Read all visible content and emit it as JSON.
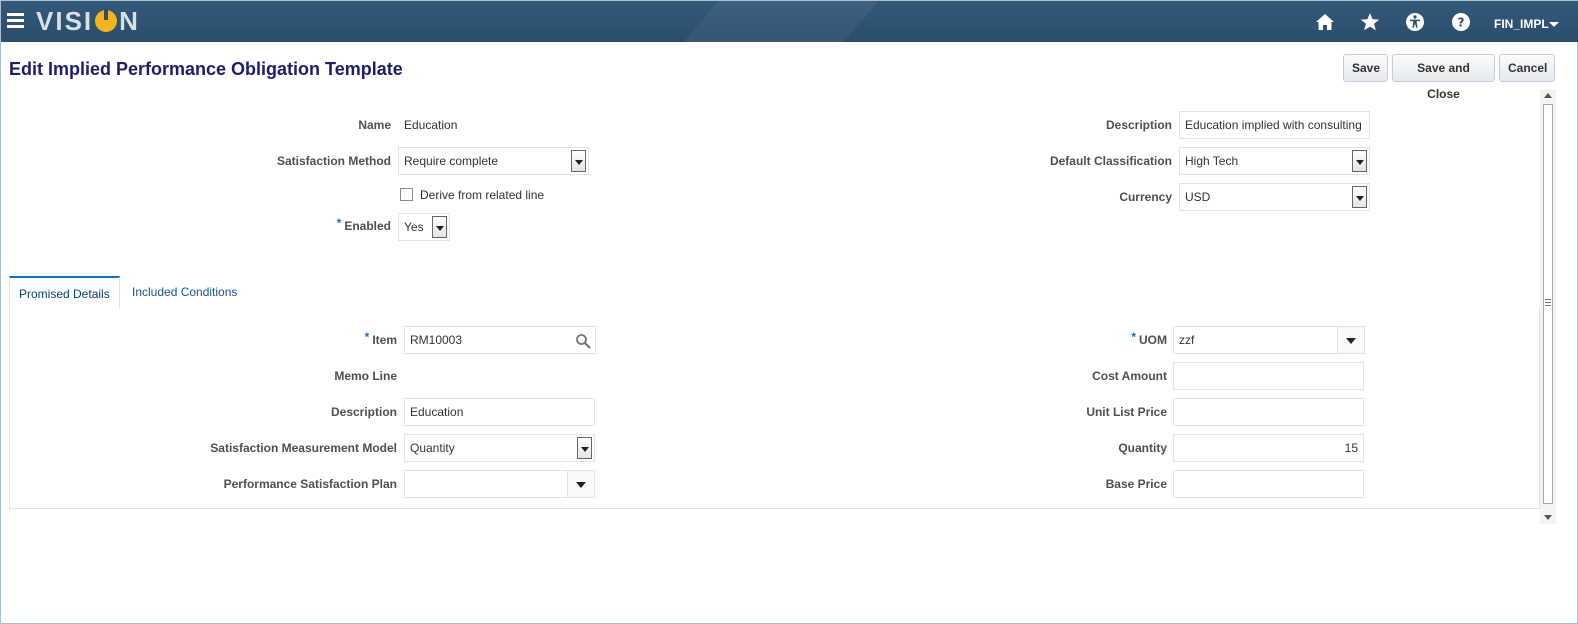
{
  "header": {
    "logo_text_left": "VISI",
    "logo_text_right": "N",
    "user": "FIN_IMPL",
    "icons": [
      "home-icon",
      "favorites-star-icon",
      "accessibility-icon",
      "help-icon"
    ]
  },
  "page": {
    "title": "Edit Implied Performance Obligation Template",
    "buttons": {
      "save": "Save",
      "save_and_close": "Save and Close",
      "cancel": "Cancel"
    }
  },
  "form": {
    "name_label": "Name",
    "name_value": "Education",
    "satisfaction_method_label": "Satisfaction Method",
    "satisfaction_method_value": "Require complete",
    "derive_label": "Derive from related line",
    "derive_checked": false,
    "enabled_label": "Enabled",
    "enabled_value": "Yes",
    "description_label": "Description",
    "description_value": "Education implied with consulting",
    "default_classification_label": "Default Classification",
    "default_classification_value": "High Tech",
    "currency_label": "Currency",
    "currency_value": "USD",
    "required_marker": "*"
  },
  "tabs": [
    {
      "label": "Promised Details",
      "active": true
    },
    {
      "label": "Included Conditions",
      "active": false
    }
  ],
  "details": {
    "item_label": "Item",
    "item_value": "RM10003",
    "memo_line_label": "Memo Line",
    "description_label": "Description",
    "description_value": "Education",
    "smm_label": "Satisfaction Measurement Model",
    "smm_value": "Quantity",
    "psp_label": "Performance Satisfaction Plan",
    "psp_value": "",
    "uom_label": "UOM",
    "uom_value": "zzf",
    "cost_amount_label": "Cost Amount",
    "cost_amount_value": "",
    "unit_list_price_label": "Unit List Price",
    "unit_list_price_value": "",
    "quantity_label": "Quantity",
    "quantity_value": "15",
    "base_price_label": "Base Price",
    "base_price_value": ""
  },
  "colors": {
    "header_bg": "#2c5070",
    "title": "#1d1d6e",
    "logo_accent": "#f3b51b",
    "tab_active_border": "#0c72c7"
  }
}
